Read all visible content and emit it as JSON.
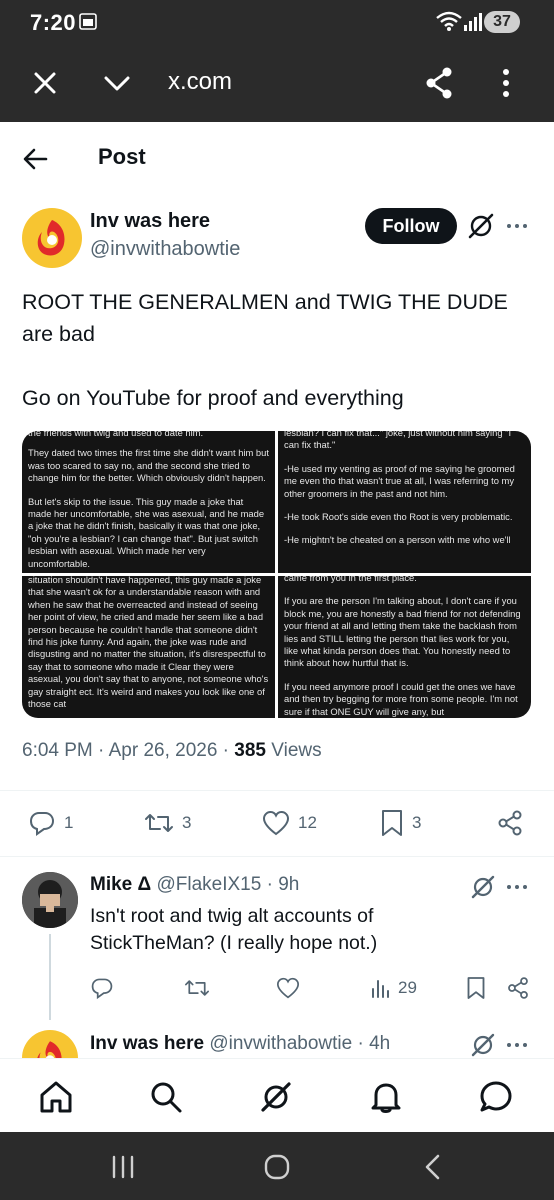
{
  "status_bar": {
    "time": "7:20",
    "battery": "37"
  },
  "browser": {
    "url": "x.com"
  },
  "header": {
    "title": "Post"
  },
  "post": {
    "author_name": "Inv was here",
    "author_handle": "@invwithabowtie",
    "follow_label": "Follow",
    "text_line1": "ROOT THE GENERALMEN and TWIG THE DUDE",
    "text_line2": "are bad",
    "text_line3": "Go on YouTube for proof and everything",
    "media": {
      "tl_top": "the friends with twig and used to date him.",
      "tl_p1": "They dated two times the first time she didn't want him but was too scared to say no, and the second she tried to change him for the better. Which obviously didn't happen.",
      "tl_p2": "But let's skip to the issue. This guy made a joke that made her uncomfortable, she was asexual, and he made a joke that he didn't finish, basically it was that one joke, \"oh you're a lesbian? I can change that\". But just switch lesbian with asexual. Which made her very uncomfortable.",
      "tr_top": "lesbian? I can fix that...\" joke, just without him saying \"I can fix that.\"",
      "tr_p1": "-He used my venting as proof of me saying he groomed me even tho that wasn't true at all, I was referring to my other groomers in the past and not him.",
      "tr_p2": "-He took Root's side even tho Root is very problematic.",
      "tr_p3": "-He mightn't be cheated on a person with me who we'll",
      "bl_top": "situation shouldn't have happened, this guy made a joke that she wasn't ok for a understandable reason with and when he saw that he overreacted and instead of seeing her point of view, he cried and made her seem like a bad person because he couldn't handle that someone didn't find his joke funny. And again, the joke was rude and disgusting and no matter the situation, it's disrespectful to say that to someone who made it Clear they were asexual, you don't say that to anyone, not someone who's gay straight ect. It's weird and makes you look like one of those cat",
      "br_top": "came from you in the first place.",
      "br_p1": "If you are the person I'm talking about, I don't care if you block me, you are honestly a bad friend for not defending your friend at all and letting them take the backlash from lies and STILL letting the person that lies work for you, like what kinda person does that. You honestly need to think about how hurtful that is.",
      "br_p2": "If you need anymore proof I could get the ones we have and then try begging for more from some people. I'm not sure if that ONE GUY will give any, but"
    },
    "timestamp": "6:04 PM · Apr 26, 2026 · ",
    "views_count": "385",
    "views_label": " Views",
    "stats": {
      "replies": "1",
      "reposts": "3",
      "likes": "12",
      "bookmarks": "3"
    }
  },
  "replies": [
    {
      "name": "Mike Δ",
      "handle": "@FlakeIX15",
      "time": " · 9h",
      "text": "Isn't root and twig alt accounts of StickTheMan? (I really hope not.)",
      "views": "29"
    },
    {
      "name": "Inv was here",
      "handle": "@invwithabowtie",
      "time": " · 4h"
    }
  ],
  "colors": {
    "accent": "#0f1419",
    "secondary": "#536471",
    "avatar_bg": "#f7c531",
    "chrome": "#2b2b2b"
  },
  "icons": [
    "close-icon",
    "chevron-down-icon",
    "share-icon",
    "kebab-icon",
    "back-arrow-icon",
    "grok-icon",
    "more-icon",
    "reply-icon",
    "repost-icon",
    "like-icon",
    "bookmark-icon",
    "share-nodes-icon",
    "views-icon",
    "home-icon",
    "search-icon",
    "notifications-icon",
    "messages-icon"
  ]
}
